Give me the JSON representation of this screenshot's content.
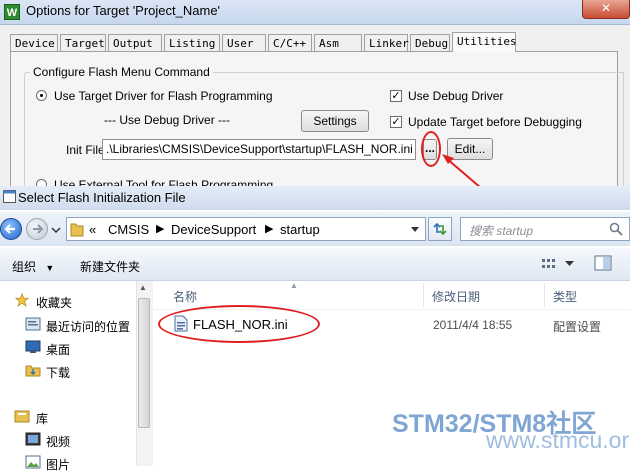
{
  "options_dialog": {
    "title": "Options for Target 'Project_Name'",
    "app_icon_letter": "W",
    "tabs": [
      {
        "label": "Device"
      },
      {
        "label": "Target"
      },
      {
        "label": "Output"
      },
      {
        "label": "Listing"
      },
      {
        "label": "User"
      },
      {
        "label": "C/C++"
      },
      {
        "label": "Asm"
      },
      {
        "label": "Linker"
      },
      {
        "label": "Debug"
      },
      {
        "label": "Utilities",
        "active": true
      }
    ],
    "group_label": "Configure Flash Menu Command",
    "use_target_driver_label": "Use Target Driver for Flash Programming",
    "use_debug_driver_note": "--- Use Debug Driver ---",
    "settings_button": "Settings",
    "use_debug_driver_label": "Use Debug Driver",
    "use_debug_driver_checked": true,
    "update_target_label": "Update Target before Debugging",
    "update_target_checked": true,
    "init_file_label": "Init File:",
    "init_file_value": ".\\Libraries\\CMSIS\\DeviceSupport\\startup\\FLASH_NOR.ini",
    "browse_button": "...",
    "edit_button": "Edit...",
    "partial_radio_label": "Use External Tool for Flash Programming"
  },
  "file_dialog": {
    "title": "Select Flash Initialization File",
    "breadcrumb": [
      "«",
      "CMSIS",
      "DeviceSupport",
      "startup"
    ],
    "search_placeholder": "搜索 startup",
    "toolbar": {
      "organize": "组织",
      "new_folder": "新建文件夹"
    },
    "nav_items": [
      {
        "label": "收藏夹",
        "icon": "star-icon",
        "header": true
      },
      {
        "label": "最近访问的位置",
        "icon": "recent-places-icon"
      },
      {
        "label": "桌面",
        "icon": "desktop-icon"
      },
      {
        "label": "下载",
        "icon": "downloads-icon"
      },
      {
        "label": "库",
        "icon": "library-icon",
        "header": true
      },
      {
        "label": "视频",
        "icon": "video-icon"
      },
      {
        "label": "图片",
        "icon": "pictures-icon"
      }
    ],
    "columns": {
      "name": "名称",
      "modified": "修改日期",
      "type": "类型"
    },
    "files": [
      {
        "name": "FLASH_NOR.ini",
        "modified": "2011/4/4 18:55",
        "type": "配置设置"
      }
    ]
  },
  "watermark": {
    "brand": "STM32/STM8社区",
    "url": "www.stmcu.org"
  },
  "colors": {
    "annotation": "#e02020",
    "accent": "#1d63c7"
  }
}
